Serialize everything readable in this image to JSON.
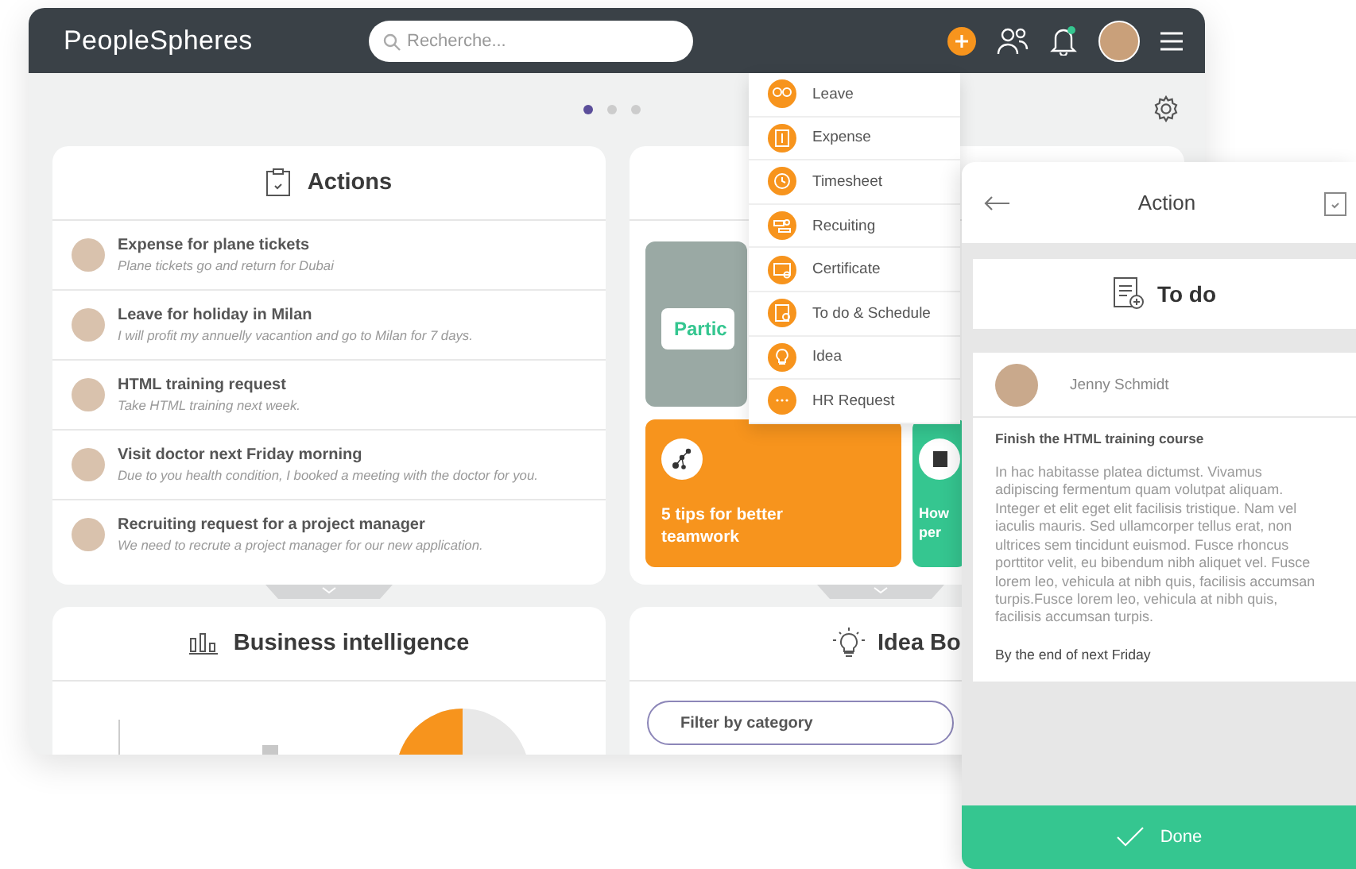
{
  "header": {
    "logo": "PeopleSpheres",
    "search": {
      "placeholder": "Recherche..."
    }
  },
  "pager": [
    {
      "selected": true
    },
    {
      "selected": false
    },
    {
      "selected": false
    }
  ],
  "actions_card": {
    "title": "Actions",
    "items": [
      {
        "title": "Expense for plane tickets",
        "subtitle": "Plane tickets go and return for Dubai"
      },
      {
        "title": "Leave for holiday in Milan",
        "subtitle": "I will profit my annuelly vacantion and go to Milan for 7 days."
      },
      {
        "title": "HTML training request",
        "subtitle": "Take HTML training next week."
      },
      {
        "title": "Visit doctor next Friday morning",
        "subtitle": "Due to you health condition, I booked a meeting with the doctor for you."
      },
      {
        "title": "Recruiting request for a project manager",
        "subtitle": "We need to recrute a project manager for our new application."
      }
    ]
  },
  "news_card": {
    "photo_caption": "Partic",
    "tiles": [
      {
        "text": "5 tips for better teamwork",
        "color": "#f7941d",
        "kind": "network"
      },
      {
        "text": "How per",
        "color": "#35c690",
        "kind": "document"
      }
    ]
  },
  "bi_card": {
    "title": "Business intelligence"
  },
  "idea_card": {
    "title": "Idea Bo",
    "filter": {
      "placeholder": "Filter by category"
    }
  },
  "new_menu": {
    "items": [
      {
        "label": "Leave",
        "kind": "leave"
      },
      {
        "label": "Expense",
        "kind": "expense"
      },
      {
        "label": "Timesheet",
        "kind": "clock"
      },
      {
        "label": "Recuiting",
        "kind": "recruit"
      },
      {
        "label": "Certificate",
        "kind": "certificate"
      },
      {
        "label": "To do & Schedule",
        "kind": "todo"
      },
      {
        "label": "Idea",
        "kind": "idea"
      },
      {
        "label": "HR Request",
        "kind": "more"
      }
    ]
  },
  "action_panel": {
    "title": "Action",
    "section": "To do",
    "author": "Jenny Schmidt",
    "task": "Finish the HTML training course",
    "body": "In hac habitasse platea dictumst. Vivamus adipiscing fermentum quam volutpat aliquam. Integer et elit eget elit facilisis tristique. Nam vel iaculis mauris. Sed ullamcorper tellus erat, non ultrices sem tincidunt euismod. Fusce rhoncus porttitor velit, eu bibendum nibh aliquet vel. Fusce lorem leo, vehicula at nibh quis, facilisis accumsan turpis.Fusce lorem leo, vehicula at nibh quis, facilisis accumsan turpis.",
    "deadline": "By the end of next Friday",
    "button": "Done"
  }
}
